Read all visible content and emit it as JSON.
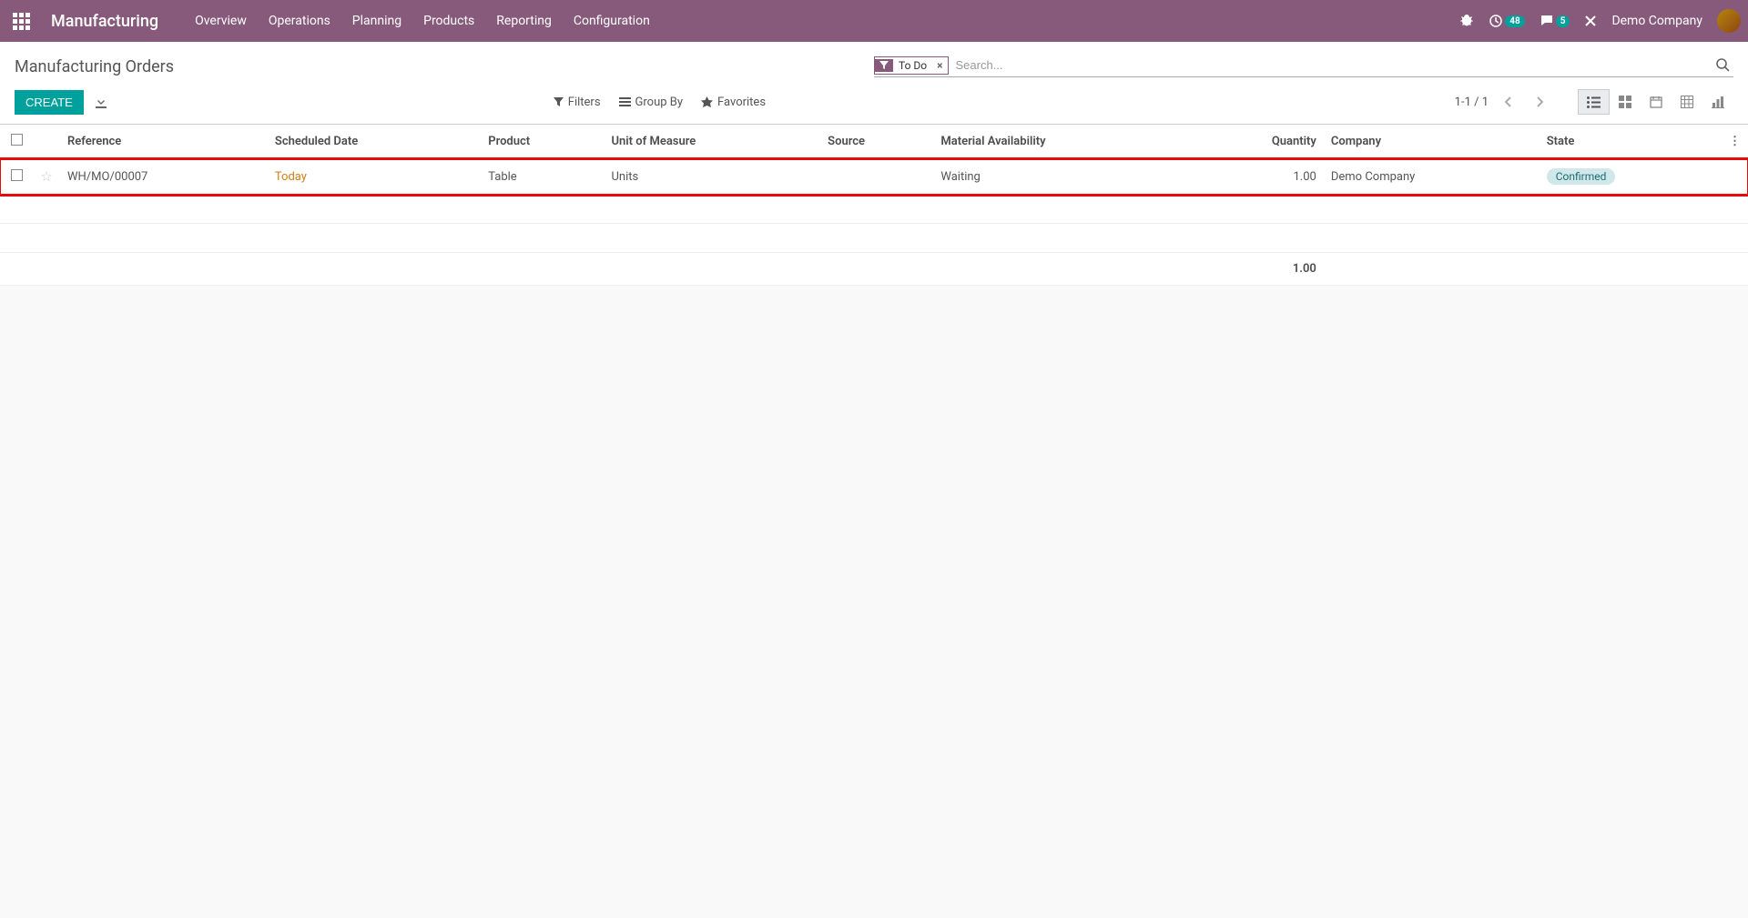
{
  "topnav": {
    "app_name": "Manufacturing",
    "links": [
      "Overview",
      "Operations",
      "Planning",
      "Products",
      "Reporting",
      "Configuration"
    ],
    "activities_badge": "48",
    "messages_badge": "5",
    "company": "Demo Company"
  },
  "control_panel": {
    "title": "Manufacturing Orders",
    "search_facet": "To Do",
    "search_placeholder": "Search...",
    "create_label": "Create",
    "filters_label": "Filters",
    "groupby_label": "Group By",
    "favorites_label": "Favorites",
    "pager": "1-1 / 1"
  },
  "table": {
    "headers": {
      "reference": "Reference",
      "scheduled_date": "Scheduled Date",
      "product": "Product",
      "uom": "Unit of Measure",
      "source": "Source",
      "material_avail": "Material Availability",
      "quantity": "Quantity",
      "company": "Company",
      "state": "State"
    },
    "rows": [
      {
        "reference": "WH/MO/00007",
        "scheduled_date": "Today",
        "product": "Table",
        "uom": "Units",
        "source": "",
        "material_avail": "Waiting",
        "quantity": "1.00",
        "company": "Demo Company",
        "state": "Confirmed"
      }
    ],
    "totals": {
      "quantity": "1.00"
    }
  }
}
